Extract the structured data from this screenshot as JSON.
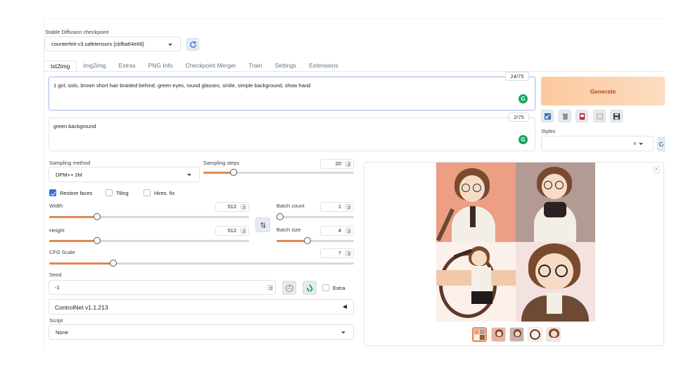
{
  "checkpoint": {
    "label": "Stable Diffusion checkpoint",
    "value": "counterfeit-v3.safetensors [cbfba64e66]"
  },
  "tabs": [
    "txt2img",
    "img2img",
    "Extras",
    "PNG Info",
    "Checkpoint Merger",
    "Train",
    "Settings",
    "Extensions"
  ],
  "active_tab": "txt2img",
  "prompt": {
    "text": "1 girl, solo, brown short hair braided behind, green eyes, round glasses, smile, simple background, show hand",
    "token_count": "24/75"
  },
  "negative_prompt": {
    "text": "green background",
    "token_count": "2/75"
  },
  "generate_label": "Generate",
  "styles": {
    "label": "Styles",
    "clear": "×"
  },
  "sampling_method": {
    "label": "Sampling method",
    "value": "DPM++ 2M"
  },
  "sampling_steps": {
    "label": "Sampling steps",
    "value": "20",
    "fraction": 0.2
  },
  "checkboxes": [
    {
      "label": "Restore faces",
      "checked": true
    },
    {
      "label": "Tiling",
      "checked": false
    },
    {
      "label": "Hires. fix",
      "checked": false
    }
  ],
  "width": {
    "label": "Width",
    "value": "512",
    "fraction": 0.24
  },
  "height": {
    "label": "Height",
    "value": "512",
    "fraction": 0.24
  },
  "batch_count": {
    "label": "Batch count",
    "value": "1",
    "fraction": 0.0
  },
  "batch_size": {
    "label": "Batch size",
    "value": "4",
    "fraction": 0.4
  },
  "cfg_scale": {
    "label": "CFG Scale",
    "value": "7",
    "fraction": 0.21
  },
  "seed": {
    "label": "Seed",
    "value": "-1",
    "extra_label": "Extra"
  },
  "controlnet": {
    "label": "ControlNet v1.1.213"
  },
  "script": {
    "label": "Script",
    "value": "None"
  },
  "gallery": {
    "close": "×",
    "thumbnail_count": 5
  },
  "colors": {
    "accent": "#e1894e",
    "generate_text": "#c0461b",
    "checkbox": "#3b6fd0",
    "badge": "#15a362"
  }
}
